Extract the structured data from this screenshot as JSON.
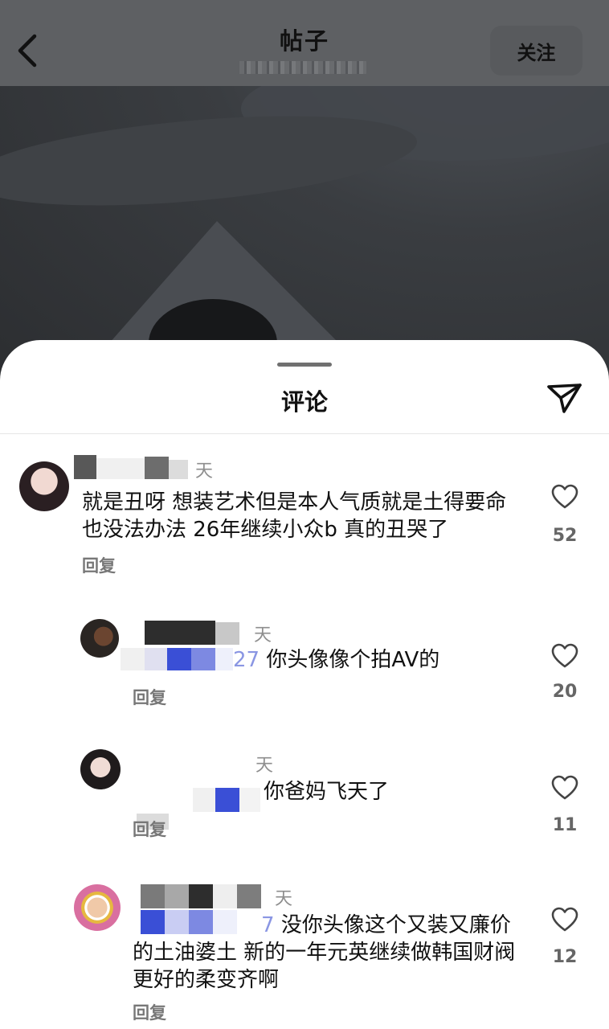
{
  "header": {
    "title": "帖子",
    "follow_label": "关注"
  },
  "sheet": {
    "title": "评论"
  },
  "comments": [
    {
      "time": "天",
      "text": "就是丑呀 想装艺术但是本人气质就是土得要命也没法办法 26年继续小众b 真的丑哭了",
      "reply": "回复",
      "likes": "52"
    },
    {
      "time": "天",
      "mention": "27",
      "text": "你头像像个拍AV的",
      "reply": "回复",
      "likes": "20"
    },
    {
      "time": "天",
      "text": "你爸妈飞天了",
      "reply": "回复",
      "likes": "11"
    },
    {
      "time": "天",
      "mention": "7",
      "text": "没你头像这个又装又廉价的土油婆土 新的一年元英继续做韩国财阀更好的柔变齐啊",
      "reply": "回复",
      "likes": "12"
    }
  ],
  "icons": {
    "back": "chevron-left-icon",
    "send": "paper-plane-icon",
    "like": "heart-outline-icon"
  },
  "colors": {
    "header_bg": "#5e6063",
    "sheet_bg": "#ffffff",
    "mention_blue": "#3a4fd6"
  }
}
